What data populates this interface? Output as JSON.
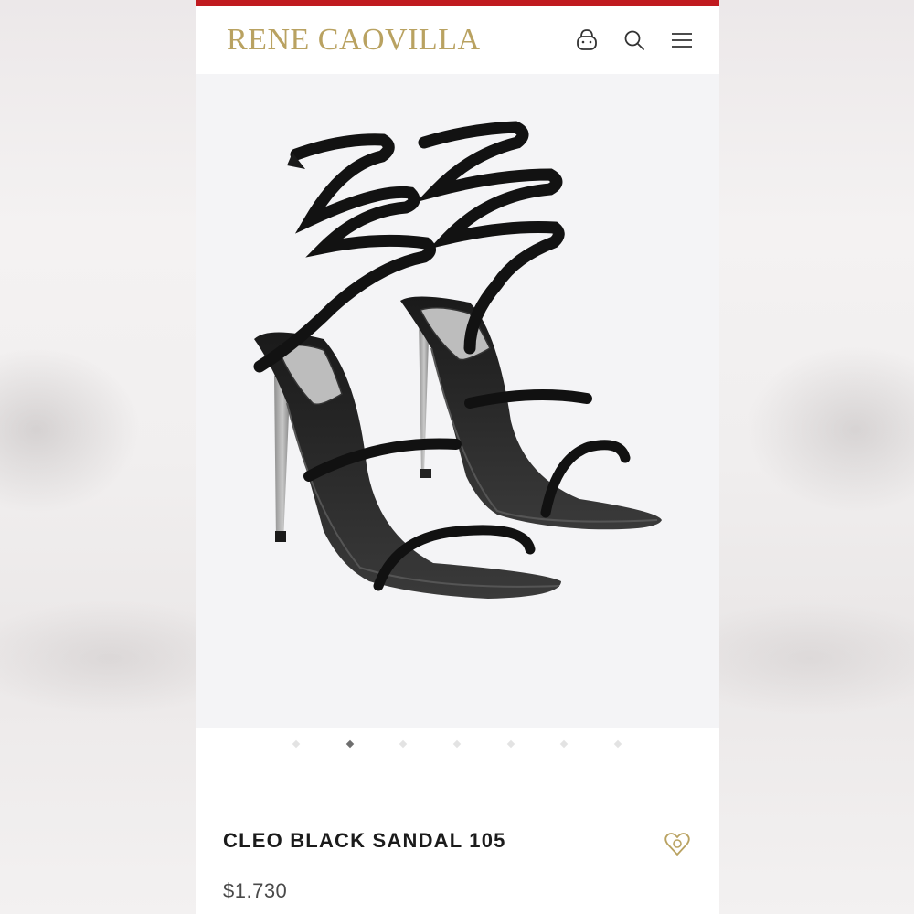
{
  "header": {
    "brand": "RENE CAOVILLA",
    "icons": [
      "bag-icon",
      "search-icon",
      "menu-icon"
    ],
    "accent_color": "#c01a1f",
    "brand_color": "#b9a261"
  },
  "gallery": {
    "image_alt": "Cleo black sandal",
    "image_count": 7,
    "active_index": 1
  },
  "product": {
    "name": "CLEO BLACK SANDAL 105",
    "price": "$1.730",
    "wishlist_icon": "heart-icon"
  }
}
